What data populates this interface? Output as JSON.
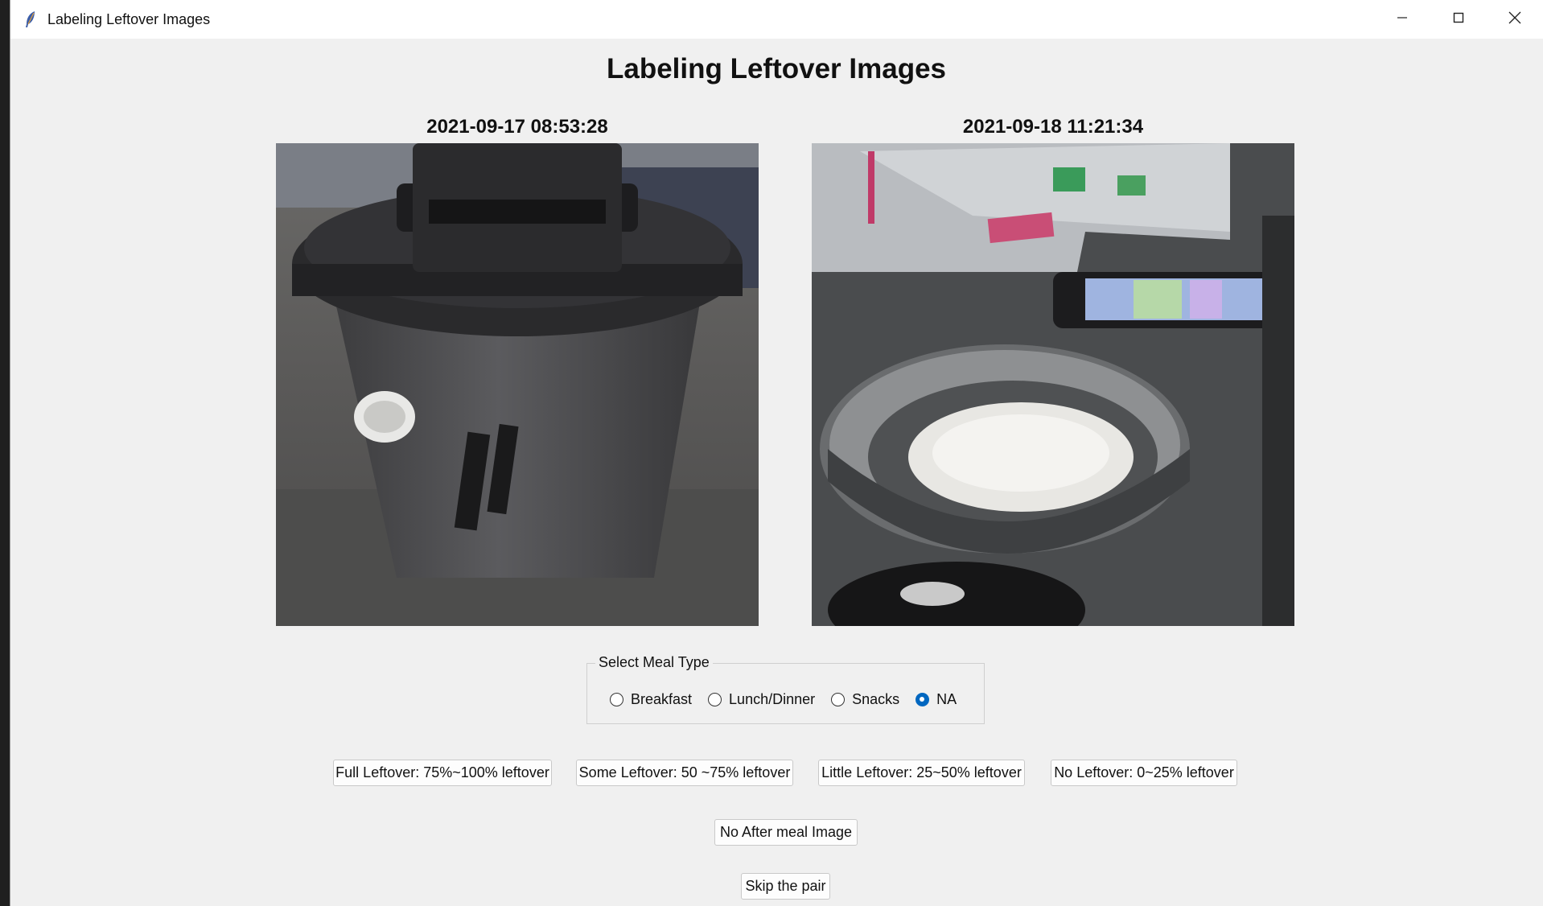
{
  "window": {
    "title": "Labeling Leftover Images"
  },
  "main": {
    "heading": "Labeling Leftover Images",
    "images": [
      {
        "timestamp": "2021-09-17 08:53:28"
      },
      {
        "timestamp": "2021-09-18 11:21:34"
      }
    ]
  },
  "meal_type": {
    "legend": "Select Meal Type",
    "options": [
      {
        "label": "Breakfast",
        "selected": false
      },
      {
        "label": "Lunch/Dinner",
        "selected": false
      },
      {
        "label": "Snacks",
        "selected": false
      },
      {
        "label": "NA",
        "selected": true
      }
    ],
    "selected_value": "NA",
    "accent_color": "#0067c0"
  },
  "leftover_buttons": [
    {
      "label": "Full Leftover: 75%~100% leftover"
    },
    {
      "label": "Some Leftover: 50 ~75% leftover"
    },
    {
      "label": "Little Leftover: 25~50% leftover"
    },
    {
      "label": "No Leftover: 0~25% leftover"
    }
  ],
  "actions": {
    "no_after_meal": "No After meal Image",
    "skip": "Skip the pair"
  },
  "icons": {
    "app": "feather-icon",
    "minimize": "minimize-icon",
    "maximize": "maximize-icon",
    "close": "close-icon"
  }
}
